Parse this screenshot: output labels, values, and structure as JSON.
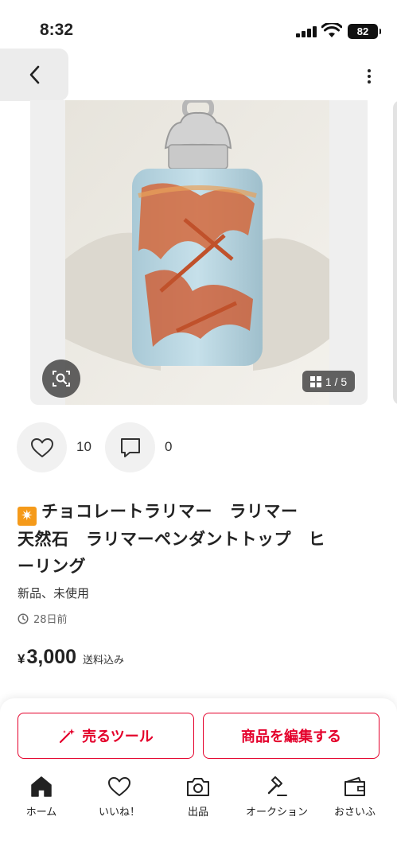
{
  "status_bar": {
    "time": "8:32",
    "battery": "82"
  },
  "nav": {
    "back_icon": "chevron-left-icon",
    "more_icon": "more-vertical-icon"
  },
  "carousel": {
    "counter": "1 / 5",
    "zoom_icon": "image-search-icon"
  },
  "reactions": {
    "likes": "10",
    "comments": "0"
  },
  "item": {
    "title_line1": "チョコレートラリマー　ラリマー",
    "title_line2": "天然石　ラリマーペンダントトップ　ヒ",
    "title_line3": "ーリング",
    "condition": "新品、未使用",
    "posted": "28日前",
    "currency": "¥",
    "price": "3,000",
    "shipping": "送料込み"
  },
  "actions": {
    "sell_tool": "売るツール",
    "edit_item": "商品を編集する"
  },
  "tabs": [
    {
      "label": "ホーム",
      "icon": "home-icon"
    },
    {
      "label": "いいね！",
      "icon": "heart-icon"
    },
    {
      "label": "出品",
      "icon": "camera-icon"
    },
    {
      "label": "オークション",
      "icon": "gavel-icon"
    },
    {
      "label": "おさいふ",
      "icon": "wallet-icon"
    }
  ],
  "colors": {
    "accent": "#e4002b",
    "background": "#ffffff"
  }
}
